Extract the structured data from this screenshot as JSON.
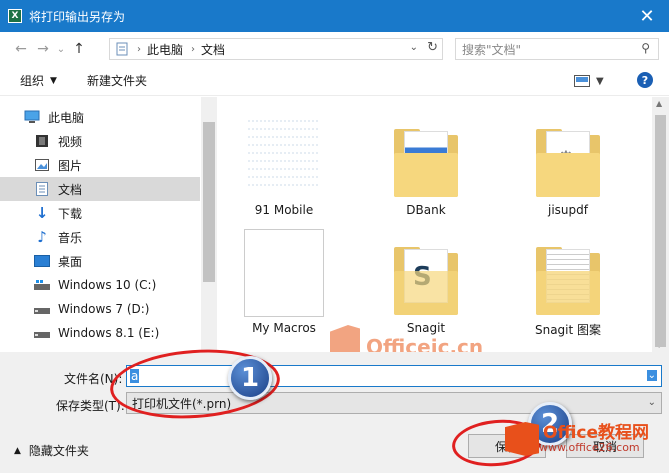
{
  "window": {
    "title": "将打印输出另存为",
    "app_icon": "X"
  },
  "nav": {
    "back_icon": "←",
    "forward_icon": "→",
    "recent_icon": "⌄",
    "up_icon": "↑"
  },
  "address": {
    "crumbs": [
      "此电脑",
      "文档"
    ],
    "separator": "›"
  },
  "search": {
    "placeholder": "搜索\"文档\""
  },
  "toolbar": {
    "organize_label": "组织",
    "new_folder_label": "新建文件夹",
    "help_label": "?"
  },
  "sidebar": {
    "items": [
      {
        "label": "此电脑",
        "icon": "monitor-icon",
        "selected": false
      },
      {
        "label": "视频",
        "icon": "video-icon",
        "selected": false
      },
      {
        "label": "图片",
        "icon": "picture-icon",
        "selected": false
      },
      {
        "label": "文档",
        "icon": "document-icon",
        "selected": true
      },
      {
        "label": "下载",
        "icon": "download-icon",
        "selected": false
      },
      {
        "label": "音乐",
        "icon": "music-icon",
        "selected": false
      },
      {
        "label": "桌面",
        "icon": "desktop-icon",
        "selected": false
      },
      {
        "label": "Windows 10 (C:)",
        "icon": "drive-icon",
        "selected": false
      },
      {
        "label": "Windows 7 (D:)",
        "icon": "drive-icon",
        "selected": false
      },
      {
        "label": "Windows 8.1 (E:)",
        "icon": "drive-icon",
        "selected": false
      }
    ]
  },
  "files": [
    {
      "name": "91 Mobile"
    },
    {
      "name": "DBank"
    },
    {
      "name": "jisupdf"
    },
    {
      "name": "My Macros"
    },
    {
      "name": "Snagit"
    },
    {
      "name": "Snagit 图案"
    }
  ],
  "form": {
    "filename_label": "文件名(N):",
    "filename_value": "a",
    "filetype_label": "保存类型(T):",
    "filetype_value": "打印机文件(*.prn)",
    "hide_folders_label": "隐藏文件夹",
    "save_label": "保存",
    "cancel_label": "取消"
  },
  "annotations": {
    "step1": "1",
    "step2": "2",
    "watermark": "Officejc.cn",
    "brand": "Office教程网",
    "brand_url": "www.office26.com"
  },
  "colors": {
    "titlebar": "#1979ca",
    "selection": "#d9d9d9",
    "annotation_red": "#e02020",
    "brand_orange": "#e8501b"
  }
}
